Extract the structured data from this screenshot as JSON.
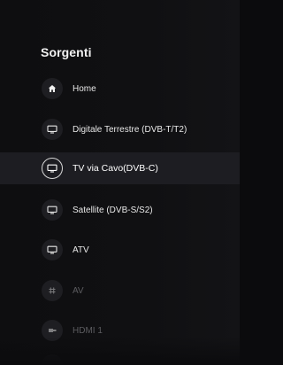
{
  "menu": {
    "title": "Sorgenti",
    "items": [
      {
        "label": "Home",
        "icon": "home-icon",
        "state": "normal"
      },
      {
        "label": "Digitale Terrestre (DVB-T/T2)",
        "icon": "tv-icon",
        "state": "normal"
      },
      {
        "label": "TV via Cavo(DVB-C)",
        "icon": "tv-icon",
        "state": "selected"
      },
      {
        "label": "Satellite (DVB-S/S2)",
        "icon": "tv-icon",
        "state": "normal"
      },
      {
        "label": "ATV",
        "icon": "tv-icon",
        "state": "normal"
      },
      {
        "label": "AV",
        "icon": "av-icon",
        "state": "disabled"
      },
      {
        "label": "HDMI 1",
        "icon": "hdmi-icon",
        "state": "disabled"
      }
    ]
  },
  "colors": {
    "background": "#0b0b0d",
    "selected_row": "#1d1d22",
    "text": "#e8e8e8",
    "disabled_text": "#5c5c60"
  }
}
